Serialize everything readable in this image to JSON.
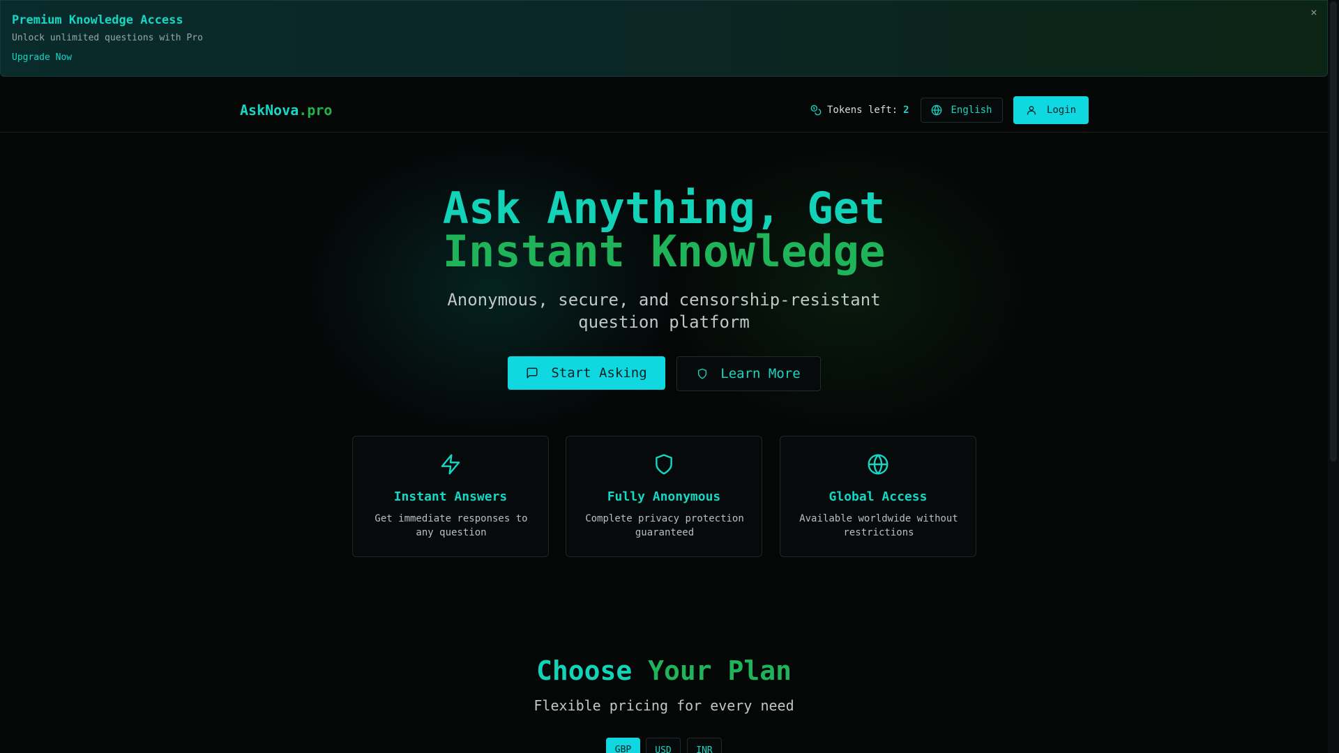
{
  "banner": {
    "title": "Premium Knowledge Access",
    "subtitle": "Unlock unlimited questions with Pro",
    "link": "Upgrade Now",
    "close": "×"
  },
  "header": {
    "logo_main": "AskNova",
    "logo_suffix": ".pro",
    "tokens_label": "Tokens left:",
    "tokens_value": "2",
    "language": "English",
    "login": "Login"
  },
  "hero": {
    "title_line1": "Ask Anything, Get",
    "title_line2": "Instant Knowledge",
    "subtitle": "Anonymous, secure, and censorship-resistant question platform",
    "start_button": "Start Asking",
    "learn_button": "Learn More"
  },
  "features": [
    {
      "title": "Instant Answers",
      "desc": "Get immediate responses to any question",
      "icon": "lightning-icon"
    },
    {
      "title": "Fully Anonymous",
      "desc": "Complete privacy protection guaranteed",
      "icon": "shield-icon"
    },
    {
      "title": "Global Access",
      "desc": "Available worldwide without restrictions",
      "icon": "globe-icon"
    }
  ],
  "pricing": {
    "title_a": "Choose",
    "title_b": "Your Plan",
    "subtitle": "Flexible pricing for every need",
    "currencies": [
      "GBP",
      "USD",
      "INR"
    ],
    "selected_currency": "GBP"
  },
  "colors": {
    "accent": "#0fd8e0",
    "teal_text": "#16d6c4",
    "green_text": "#1fb35a",
    "background": "#050707"
  }
}
